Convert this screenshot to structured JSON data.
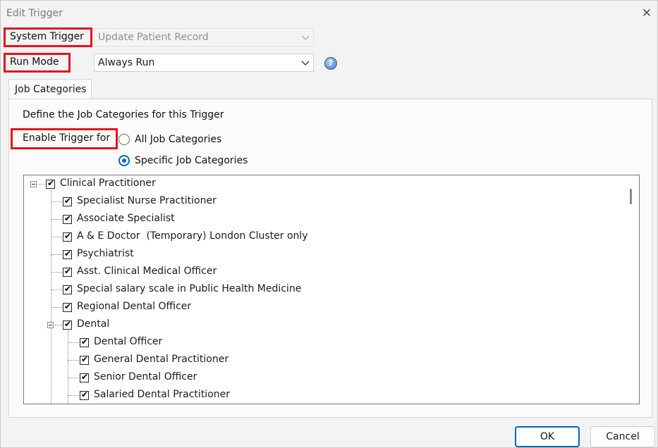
{
  "window": {
    "title": "Edit Trigger",
    "close_icon": "close-icon"
  },
  "system_trigger": {
    "label": "System Trigger",
    "value": "Update Patient Record"
  },
  "run_mode": {
    "label": "Run Mode",
    "value": "Always Run"
  },
  "tab": {
    "label": "Job Categories"
  },
  "panel": {
    "description": "Define the Job Categories for this Trigger",
    "enable_label": "Enable Trigger for",
    "options": [
      {
        "label": "All Job Categories",
        "checked": false
      },
      {
        "label": "Specific Job Categories",
        "checked": true
      }
    ]
  },
  "tree": {
    "items": [
      {
        "label": "Clinical Practitioner",
        "checked": true
      },
      {
        "label": "Specialist Nurse Practitioner",
        "checked": true
      },
      {
        "label": "Associate Specialist",
        "checked": true
      },
      {
        "label": "A & E Doctor  (Temporary) London Cluster only",
        "checked": true
      },
      {
        "label": "Psychiatrist",
        "checked": true
      },
      {
        "label": "Asst. Clinical Medical Officer",
        "checked": true
      },
      {
        "label": "Special salary scale in Public Health Medicine",
        "checked": true
      },
      {
        "label": "Regional Dental Officer",
        "checked": true
      },
      {
        "label": "Dental",
        "checked": true
      },
      {
        "label": "Dental Officer",
        "checked": true
      },
      {
        "label": "General Dental Practitioner",
        "checked": true
      },
      {
        "label": "Senior Dental Officer",
        "checked": true
      },
      {
        "label": "Salaried Dental Practitioner",
        "checked": true
      }
    ]
  },
  "buttons": {
    "ok": "OK",
    "cancel": "Cancel"
  },
  "colors": {
    "highlight_box": "#e3141d",
    "accent": "#0067c0"
  }
}
